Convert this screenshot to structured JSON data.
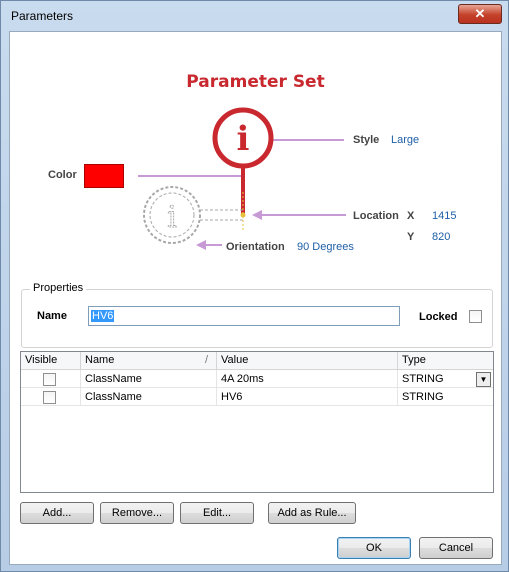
{
  "window": {
    "title": "Parameters",
    "close_glyph": "✕"
  },
  "diagram": {
    "title": "Parameter Set",
    "style_label": "Style",
    "style_value": "Large",
    "color_label": "Color",
    "color_value": "#ff0000",
    "location_label": "Location",
    "x_label": "X",
    "x_value": "1415",
    "y_label": "Y",
    "y_value": "820",
    "orientation_label": "Orientation",
    "orientation_value": "90 Degrees",
    "icon_glyph": "i",
    "accent": "#c8282e",
    "callout": "#c79ad6"
  },
  "properties": {
    "legend": "Properties",
    "name_label": "Name",
    "name_value": "HV6",
    "locked_label": "Locked",
    "locked": false
  },
  "grid": {
    "columns": [
      "Visible",
      "Name",
      "Value",
      "Type"
    ],
    "sort_indicator": "/",
    "rows": [
      {
        "visible": false,
        "name": "ClassName",
        "value": "4A 20ms",
        "type": "STRING"
      },
      {
        "visible": false,
        "name": "ClassName",
        "value": "HV6",
        "type": "STRING"
      }
    ],
    "dropdown_glyph": "▼"
  },
  "buttons": {
    "add": "Add...",
    "remove": "Remove...",
    "edit": "Edit...",
    "add_rule": "Add as Rule...",
    "ok": "OK",
    "cancel": "Cancel"
  }
}
